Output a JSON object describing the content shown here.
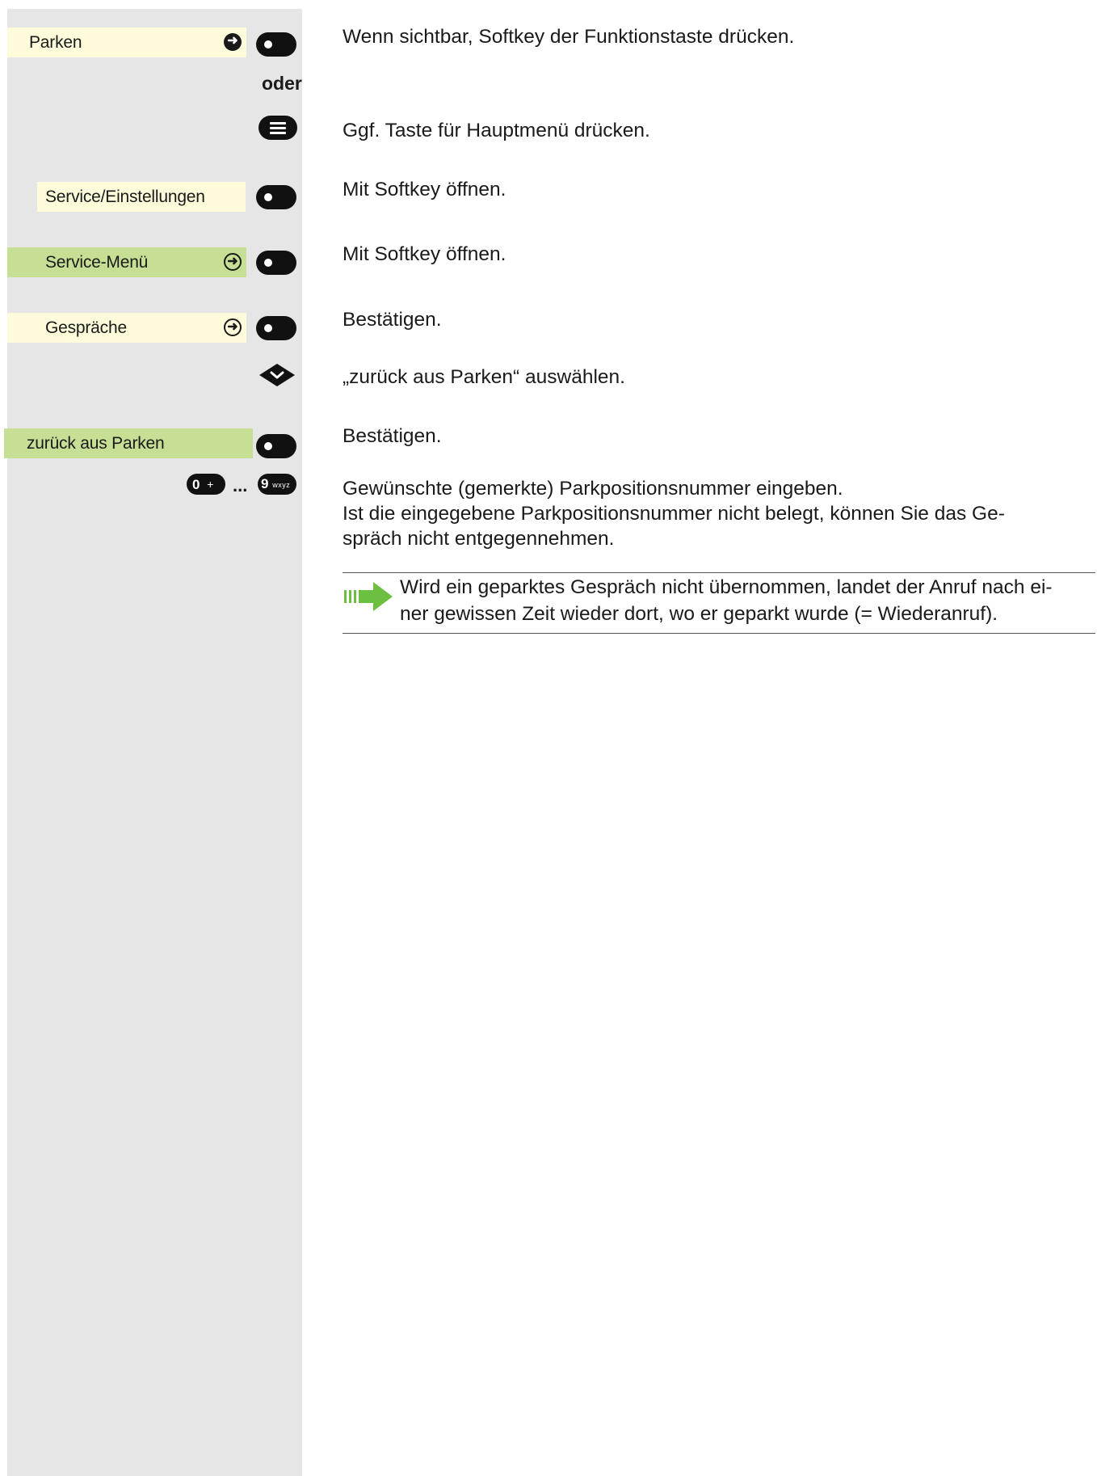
{
  "menu_items": [
    {
      "label": "Parken"
    },
    {
      "label": "Service/Einstellungen"
    },
    {
      "label": "Service-Menü"
    },
    {
      "label": "Gespräche"
    },
    {
      "label": "zurück aus Parken"
    }
  ],
  "or_label": "oder",
  "keys": {
    "num_start": "0",
    "num_start_sub": "+",
    "ellipsis": "...",
    "num_end": "9",
    "num_end_sub": "wxyz"
  },
  "instructions": [
    "Wenn sichtbar, Softkey der Funktionstaste drücken.",
    "Ggf. Taste für Hauptmenü drücken.",
    "Mit Softkey öffnen.",
    "Mit Softkey öffnen.",
    "Bestätigen.",
    "„zurück aus Parken“ auswählen.",
    "Bestätigen.",
    "Gewünschte (gemerkte) Parkpositionsnummer eingeben.",
    "Ist die eingegebene Parkpositionsnummer nicht belegt, können Sie das Ge-",
    "spräch nicht entgegennehmen."
  ],
  "note": {
    "line1": "Wird ein geparktes Gespräch nicht übernommen, landet der Anruf nach ei-",
    "line2": "ner gewissen Zeit wieder dort, wo er geparkt wurde (= Wiederanruf)."
  },
  "colors": {
    "sidebar": "#e6e6e6",
    "menu_yellow": "#fdfbd9",
    "menu_green": "#c7df95",
    "note_arrow": "#6cbf3f"
  }
}
